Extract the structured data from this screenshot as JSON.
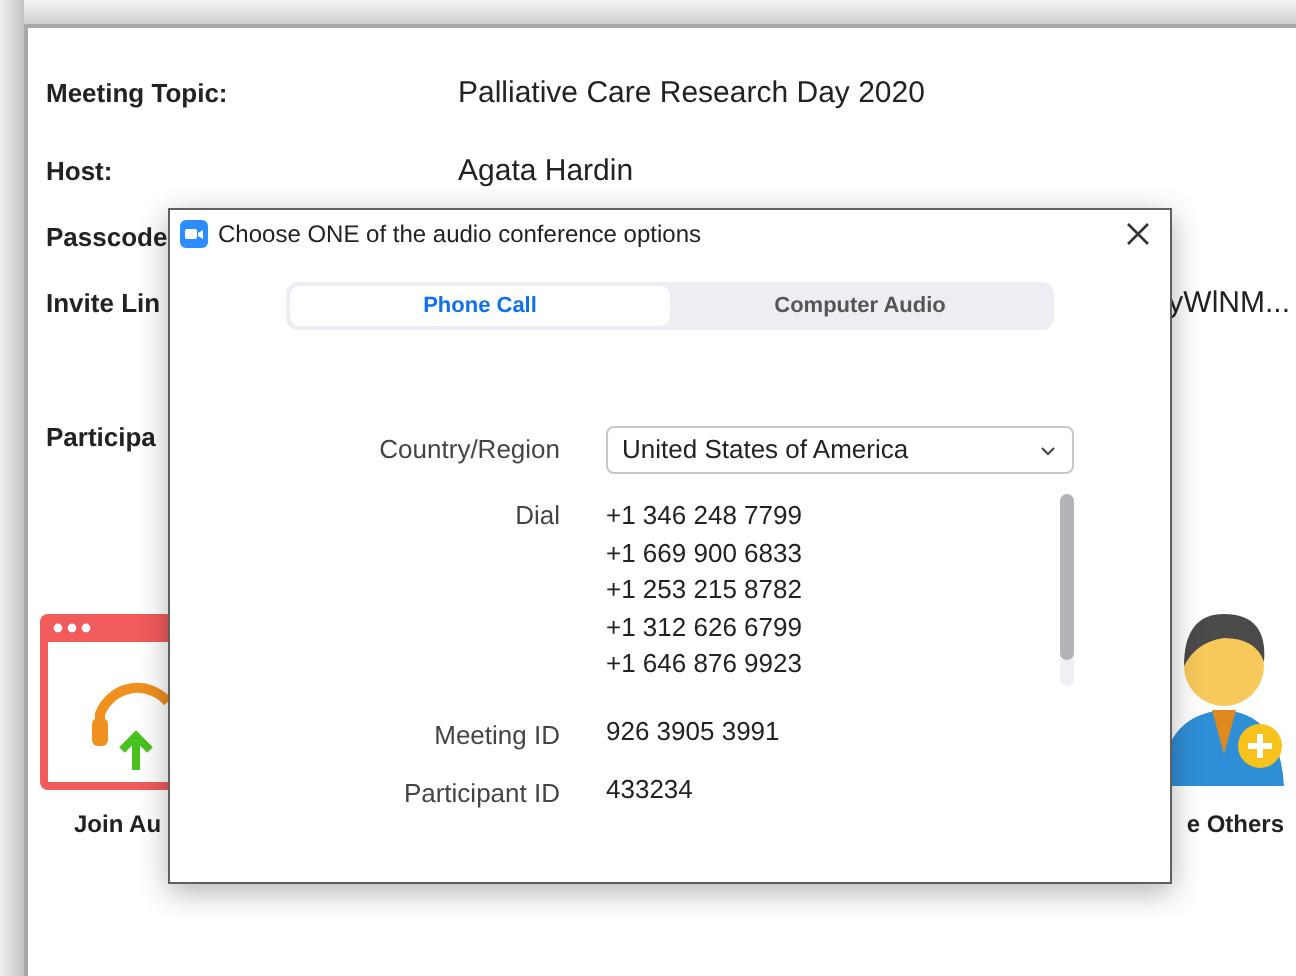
{
  "window": {
    "fields": [
      {
        "label": "Meeting Topic:",
        "value": "Palliative Care Research Day 2020"
      },
      {
        "label": "Host:",
        "value": "Agata Hardin"
      },
      {
        "label": "Passcode"
      },
      {
        "label": "Invite Lin",
        "value": "yWlNM..."
      },
      {
        "label": "Participa"
      }
    ],
    "actions": [
      {
        "label": "Join Au",
        "kind": "audio"
      },
      {
        "label": "e Others",
        "kind": "invite"
      }
    ]
  },
  "dialog": {
    "title": "Choose ONE of the audio conference options",
    "tabs": [
      {
        "label": "Phone Call",
        "selected": true
      },
      {
        "label": "Computer Audio",
        "selected": false
      }
    ],
    "country": {
      "label": "Country/Region",
      "value": "United States of America"
    },
    "dial": {
      "label": "Dial",
      "numbers": [
        "+1 346 248 7799",
        "+1 669 900 6833",
        "+1 253 215 8782",
        "+1 312 626 6799",
        "+1 646 876 9923"
      ]
    },
    "meeting_id": {
      "label": "Meeting ID",
      "value": "926 3905 3991"
    },
    "participant_id": {
      "label": "Participant ID",
      "value": "433234"
    }
  }
}
